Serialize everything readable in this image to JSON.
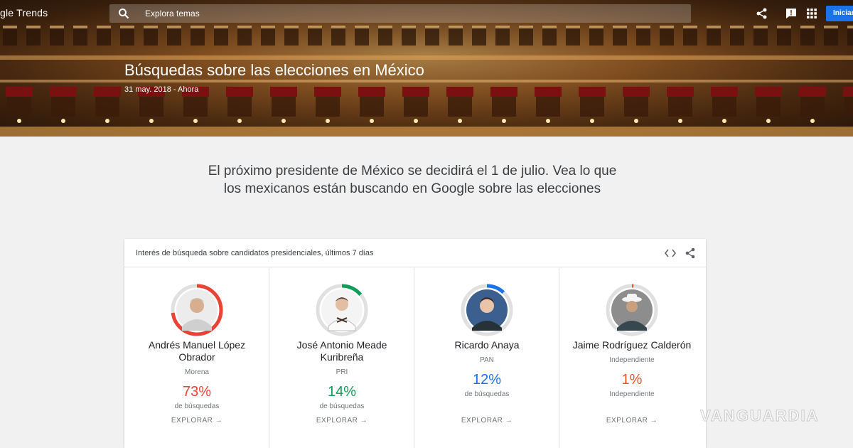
{
  "header": {
    "logo": "gle Trends",
    "search_placeholder": "Explora temas",
    "signin_label": "Iniciar",
    "title": "Búsquedas sobre las elecciones en México",
    "date_range": "31 may. 2018 - Ahora"
  },
  "intro": "El próximo presidente de México se decidirá el 1 de julio. Vea lo que los mexicanos están buscando en Google sobre las elecciones",
  "card": {
    "title": "Interés de búsqueda sobre candidatos presidenciales, últimos 7 días",
    "candidates": [
      {
        "name": "Andrés Manuel López Obrador",
        "party": "Morena",
        "percent": "73%",
        "share": 73,
        "subtitle": "de búsquedas",
        "explore": "EXPLORAR →",
        "color": "#ea4335"
      },
      {
        "name": "José Antonio Meade Kuribreña",
        "party": "PRI",
        "percent": "14%",
        "share": 14,
        "subtitle": "de búsquedas",
        "explore": "EXPLORAR →",
        "color": "#0f9d58"
      },
      {
        "name": "Ricardo Anaya",
        "party": "PAN",
        "percent": "12%",
        "share": 12,
        "subtitle": "de búsquedas",
        "explore": "EXPLORAR →",
        "color": "#1a73e8"
      },
      {
        "name": "Jaime Rodríguez Calderón",
        "party": "Independiente",
        "percent": "1%",
        "share": 1,
        "subtitle": "Independiente",
        "explore": "EXPLORAR →",
        "color": "#f4511e"
      }
    ]
  },
  "watermark": "VANGUARDIA"
}
